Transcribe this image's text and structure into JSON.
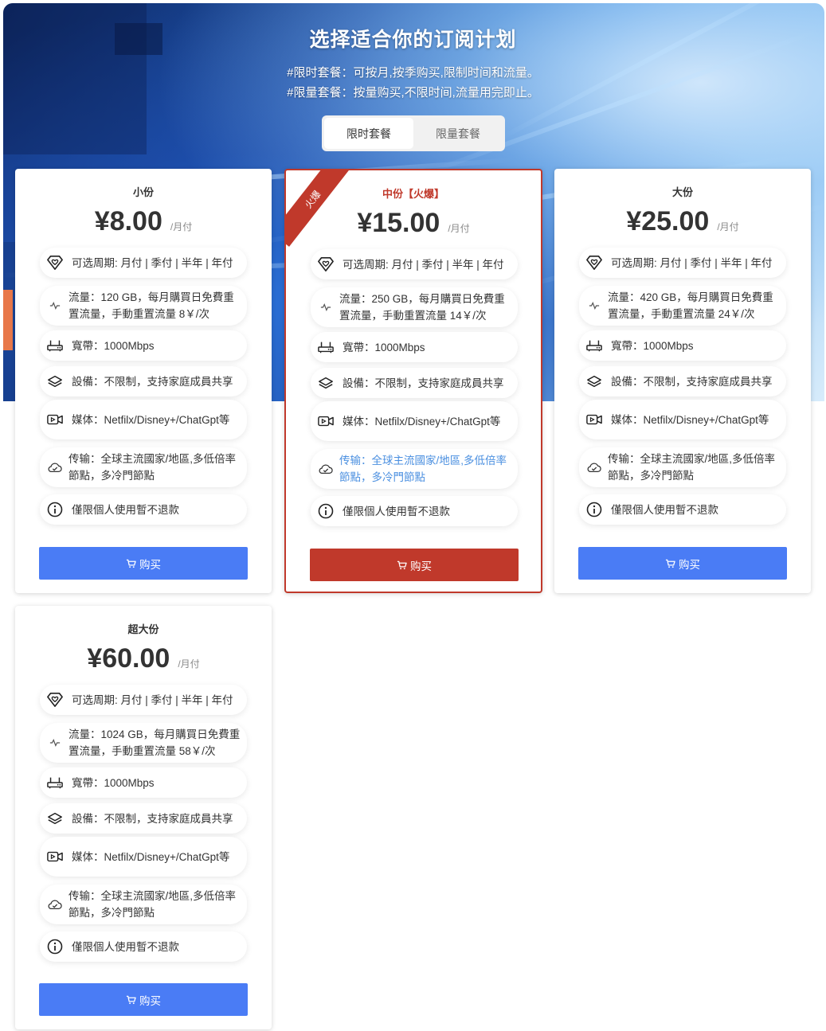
{
  "header": {
    "title": "选择适合你的订阅计划",
    "desc1": "#限时套餐：可按月,按季购买,限制时间和流量。",
    "desc2": "#限量套餐：按量购买,不限时间,流量用完即止。",
    "tabs": [
      "限时套餐",
      "限量套餐"
    ],
    "active_tab": "限时套餐"
  },
  "accent_colors": {
    "primary": "#4a7cf5",
    "hot": "#c0392b",
    "link": "#4a8fe0"
  },
  "plans": [
    {
      "name": "小份",
      "price": "¥8.00",
      "per": "/月付",
      "features": [
        {
          "icon": "diamond-heart-icon",
          "text": "可选周期: 月付 | 季付 | 半年 | 年付"
        },
        {
          "icon": "pulse-icon",
          "text": "流量：120 GB，每月購買日免費重置流量，手動重置流量 8￥/次"
        },
        {
          "icon": "router-icon",
          "text": "寬帶：1000Mbps"
        },
        {
          "icon": "layers-icon",
          "text": "設備：不限制，支持家庭成員共享"
        },
        {
          "icon": "video-icon",
          "text": "媒体：Netfilx/Disney+/ChatGpt等"
        },
        {
          "icon": "cloud-check-icon",
          "text": "传输：全球主流國家/地區,多低倍率節點，多冷門節點"
        },
        {
          "icon": "info-icon",
          "text": "僅限個人使用暫不退款"
        }
      ],
      "button": "购买"
    },
    {
      "name": "中份【火爆】",
      "price": "¥15.00",
      "per": "/月付",
      "badge": "火爆",
      "features": [
        {
          "icon": "diamond-heart-icon",
          "text": "可选周期: 月付 | 季付 | 半年 | 年付"
        },
        {
          "icon": "pulse-icon",
          "text": "流量：250 GB，每月購買日免費重置流量，手動重置流量 14￥/次"
        },
        {
          "icon": "router-icon",
          "text": "寬帶：1000Mbps"
        },
        {
          "icon": "layers-icon",
          "text": "設備：不限制，支持家庭成員共享"
        },
        {
          "icon": "video-icon",
          "text": "媒体：Netfilx/Disney+/ChatGpt等"
        },
        {
          "icon": "cloud-check-icon",
          "text": "传输：全球主流國家/地區,多低倍率節點，多冷門節點"
        },
        {
          "icon": "info-icon",
          "text": "僅限個人使用暫不退款"
        }
      ],
      "button": "购买"
    },
    {
      "name": "大份",
      "price": "¥25.00",
      "per": "/月付",
      "features": [
        {
          "icon": "diamond-heart-icon",
          "text": "可选周期: 月付 | 季付 | 半年 | 年付"
        },
        {
          "icon": "pulse-icon",
          "text": "流量：420 GB，每月購買日免費重置流量，手動重置流量 24￥/次"
        },
        {
          "icon": "router-icon",
          "text": "寬帶：1000Mbps"
        },
        {
          "icon": "layers-icon",
          "text": "設備：不限制，支持家庭成員共享"
        },
        {
          "icon": "video-icon",
          "text": "媒体：Netfilx/Disney+/ChatGpt等"
        },
        {
          "icon": "cloud-check-icon",
          "text": "传输：全球主流國家/地區,多低倍率節點，多冷門節點"
        },
        {
          "icon": "info-icon",
          "text": "僅限個人使用暫不退款"
        }
      ],
      "button": "购买"
    },
    {
      "name": "超大份",
      "price": "¥60.00",
      "per": "/月付",
      "features": [
        {
          "icon": "diamond-heart-icon",
          "text": "可选周期: 月付 | 季付 | 半年 | 年付"
        },
        {
          "icon": "pulse-icon",
          "text": "流量：1024 GB，每月購買日免費重置流量，手動重置流量 58￥/次"
        },
        {
          "icon": "router-icon",
          "text": "寬帶：1000Mbps"
        },
        {
          "icon": "layers-icon",
          "text": "設備：不限制，支持家庭成員共享"
        },
        {
          "icon": "video-icon",
          "text": "媒体：Netfilx/Disney+/ChatGpt等"
        },
        {
          "icon": "cloud-check-icon",
          "text": "传输：全球主流國家/地區,多低倍率節點，多冷門節點"
        },
        {
          "icon": "info-icon",
          "text": "僅限個人使用暫不退款"
        }
      ],
      "button": "购买"
    }
  ]
}
